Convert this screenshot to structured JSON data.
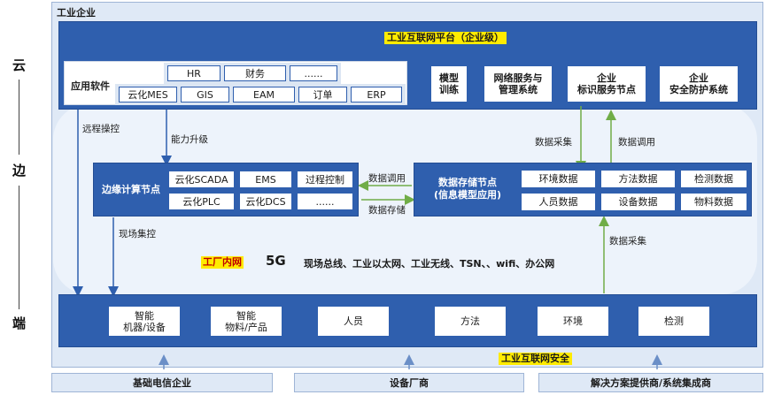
{
  "side_labels": {
    "cloud": "云",
    "edge": "边",
    "device": "端"
  },
  "enterprise_label": "工业企业",
  "platform_title": "工业互联网平台（企业级）",
  "app_software": {
    "label": "应用软件",
    "row1": [
      "HR",
      "财务",
      "......"
    ],
    "row2": [
      "云化MES",
      "GIS",
      "EAM",
      "订单",
      "ERP"
    ]
  },
  "platform_modules": [
    "模型\n训练",
    "网络服务与\n管理系统",
    "企业\n标识服务节点",
    "企业\n安全防护系统"
  ],
  "arrows": {
    "remote_control": "远程操控",
    "capability_upgrade": "能力升级",
    "data_collect_top": "数据采集",
    "data_invoke_top": "数据调用",
    "data_invoke_mid": "数据调用",
    "data_store_mid": "数据存储",
    "field_control": "现场集控",
    "data_collect_bottom": "数据采集"
  },
  "edge_node": {
    "label": "边缘计算节点",
    "items": [
      "云化SCADA",
      "EMS",
      "过程控制",
      "云化PLC",
      "云化DCS",
      "......"
    ]
  },
  "storage_node": {
    "label": "数据存储节点\n(信息模型应用)",
    "items": [
      "环境数据",
      "方法数据",
      "检测数据",
      "人员数据",
      "设备数据",
      "物料数据"
    ]
  },
  "network": {
    "label": "工厂内网",
    "fiveg": "5G",
    "items": "现场总线、工业以太网、工业无线、TSN、、wifi、办公网"
  },
  "devices": [
    "智能\n机器/设备",
    "智能\n物料/产品",
    "人员",
    "方法",
    "环境",
    "检测"
  ],
  "security_label": "工业互联网安全",
  "providers": [
    "基础电信企业",
    "设备厂商",
    "解决方案提供商/系统集成商"
  ],
  "colors": {
    "blue": "#2f5fae",
    "green": "#70ad47",
    "yellow": "#ffeb00",
    "panel": "#dfe9f6"
  }
}
